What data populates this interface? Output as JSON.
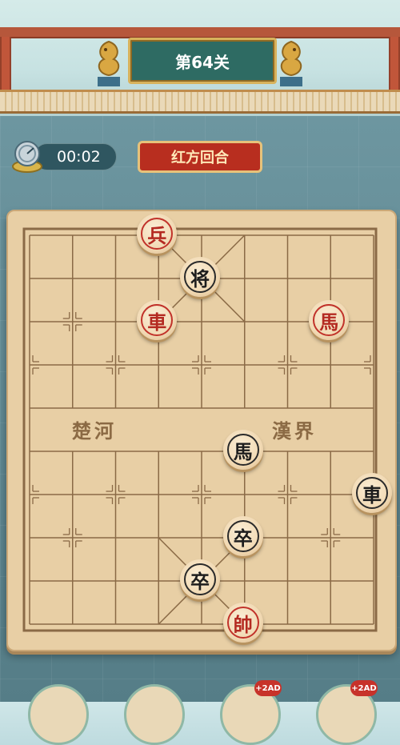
{
  "level": {
    "title": "第64关"
  },
  "timer": {
    "value": "00:02"
  },
  "turn": {
    "label": "红方回合"
  },
  "river": {
    "left": "楚河",
    "right": "漢界"
  },
  "pieces": [
    {
      "id": "red-soldier",
      "char": "兵",
      "side": "red",
      "col": 3,
      "row": 0
    },
    {
      "id": "black-general",
      "char": "将",
      "side": "black",
      "col": 4,
      "row": 1
    },
    {
      "id": "red-chariot-1",
      "char": "車",
      "side": "red",
      "col": 3,
      "row": 2
    },
    {
      "id": "red-horse-1",
      "char": "馬",
      "side": "red",
      "col": 7,
      "row": 2
    },
    {
      "id": "black-horse",
      "char": "馬",
      "side": "black",
      "col": 5,
      "row": 5
    },
    {
      "id": "black-chariot",
      "char": "車",
      "side": "black",
      "col": 8,
      "row": 6
    },
    {
      "id": "black-pawn-1",
      "char": "卒",
      "side": "black",
      "col": 5,
      "row": 7
    },
    {
      "id": "black-pawn-2",
      "char": "卒",
      "side": "black",
      "col": 4,
      "row": 8
    },
    {
      "id": "red-marshal",
      "char": "帥",
      "side": "red",
      "col": 5,
      "row": 9
    }
  ],
  "bottom_bar": {
    "ad_badges": [
      "+2",
      "+2"
    ],
    "ad_label": "AD"
  },
  "colors": {
    "red": "#b42a21",
    "black": "#1d1d1d",
    "board": "#e8cfa5",
    "turn_badge": "#b82e1f"
  }
}
